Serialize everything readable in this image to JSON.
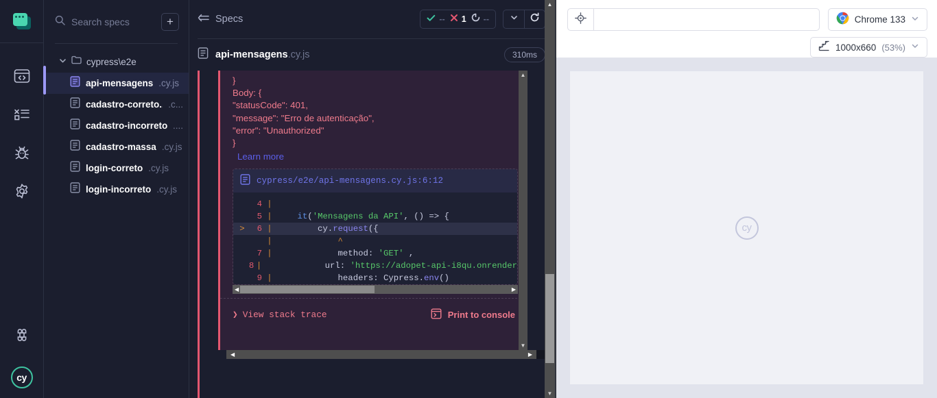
{
  "rail": {
    "logo_name": "cypress-logo",
    "items": [
      {
        "name": "specs",
        "icon": "code-window-icon",
        "active": true
      },
      {
        "name": "runs",
        "icon": "runs-list-icon",
        "active": false
      },
      {
        "name": "debug",
        "icon": "bug-icon",
        "active": false
      },
      {
        "name": "settings",
        "icon": "gear-icon",
        "active": false
      }
    ],
    "bottom": [
      {
        "name": "keyboard-shortcuts",
        "icon": "command-key-icon"
      },
      {
        "name": "cypress-account",
        "icon": "cy-circle-icon",
        "label": "cy"
      }
    ]
  },
  "sidebar": {
    "search": {
      "placeholder": "Search specs",
      "value": "",
      "icon": "search-icon"
    },
    "add_button_label": "+",
    "folder": {
      "name": "cypress\\e2e",
      "icon": "folder-icon",
      "expanded": true
    },
    "specs": [
      {
        "name": "api-mensagens",
        "ext": ".cy.js",
        "active": true
      },
      {
        "name": "cadastro-correto..",
        "ext": ".c...",
        "active": false
      },
      {
        "name": "cadastro-incorreto",
        "ext": "....",
        "active": false
      },
      {
        "name": "cadastro-massa",
        "ext": ".cy.js",
        "active": false
      },
      {
        "name": "login-correto",
        "ext": ".cy.js",
        "active": false
      },
      {
        "name": "login-incorreto",
        "ext": ".cy.js",
        "active": false
      }
    ]
  },
  "runner": {
    "back_label": "Specs",
    "stats": {
      "passed": "--",
      "failed": "1",
      "pending": "--"
    },
    "spec": {
      "name": "api-mensagens",
      "ext": ".cy.js",
      "duration": "310ms"
    },
    "error": {
      "lines": [
        "}",
        "Body: {",
        "\"statusCode\": 401,",
        "\"message\": \"Erro de autenticação\",",
        "\"error\": \"Unauthorized\"",
        "}"
      ],
      "learn_more": "Learn more",
      "code_path": "cypress/e2e/api-mensagens.cy.js:6:12",
      "code_lines": [
        {
          "num": "4",
          "marker": "",
          "tokens": []
        },
        {
          "num": "5",
          "marker": "",
          "tokens": [
            {
              "t": "    ",
              "c": "pl"
            },
            {
              "t": "it",
              "c": "kw"
            },
            {
              "t": "(",
              "c": "pl"
            },
            {
              "t": "'Mensagens da API'",
              "c": "str"
            },
            {
              "t": ", () => {",
              "c": "pl"
            }
          ]
        },
        {
          "num": "6",
          "marker": ">",
          "highlight": true,
          "tokens": [
            {
              "t": "        cy.",
              "c": "pl"
            },
            {
              "t": "request",
              "c": "fn"
            },
            {
              "t": "({",
              "c": "pl"
            }
          ]
        },
        {
          "num": "",
          "marker": "",
          "caret": "            ^"
        },
        {
          "num": "7",
          "marker": "",
          "tokens": [
            {
              "t": "            method: ",
              "c": "pl"
            },
            {
              "t": "'GET'",
              "c": "str"
            },
            {
              "t": " ,",
              "c": "pl"
            }
          ]
        },
        {
          "num": "8",
          "marker": "",
          "tokens": [
            {
              "t": "            url: ",
              "c": "pl"
            },
            {
              "t": "'https://adopet-api-i8qu.onrender",
              "c": "str"
            }
          ]
        },
        {
          "num": "9",
          "marker": "",
          "tokens": [
            {
              "t": "            headers: Cypress.",
              "c": "pl"
            },
            {
              "t": "env",
              "c": "fn"
            },
            {
              "t": "()",
              "c": "pl"
            }
          ]
        }
      ],
      "view_stack_trace": "View stack trace",
      "print_to_console": "Print to console"
    }
  },
  "preview": {
    "url": {
      "value": "",
      "placeholder": "",
      "selector_icon": "selector-playground-icon"
    },
    "browser": {
      "label": "Chrome 133",
      "icon": "chrome-icon"
    },
    "viewport": {
      "size": "1000x660",
      "scale": "(53%)",
      "icon": "ruler-icon"
    },
    "watermark": "cy"
  },
  "colors": {
    "accent_purple": "#9c98f5",
    "error_red": "#e45770",
    "pass_green": "#3ec3a0",
    "bg_dark": "#1b1e2e",
    "err_bg": "#2e2138"
  }
}
